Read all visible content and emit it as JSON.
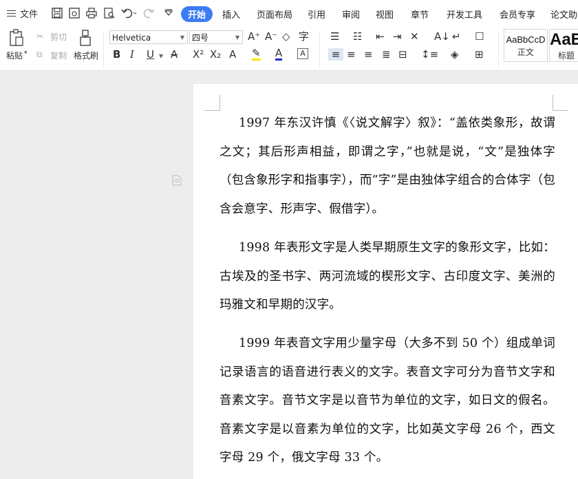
{
  "menubar": {
    "file_label": "文件",
    "quick_access": [
      "save-icon",
      "save-as-icon",
      "print-icon",
      "print-preview-icon",
      "undo-icon",
      "redo-icon",
      "more-icon"
    ],
    "tabs": [
      "开始",
      "插入",
      "页面布局",
      "引用",
      "审阅",
      "视图",
      "章节",
      "开发工具",
      "会员专享",
      "论文助手"
    ],
    "active_tab": "开始",
    "accent_color": "#3c7cf4"
  },
  "ribbon": {
    "paste_label": "粘贴",
    "cut_label": "剪切",
    "copy_label": "复制",
    "format_painter_label": "格式刷",
    "font_name": "Helvetica",
    "font_size": "四号",
    "bold": "B",
    "italic": "I",
    "underline": "U",
    "styles": [
      {
        "preview": "AaBbCcD",
        "label": "正文"
      },
      {
        "preview": "AaB",
        "label": "标题"
      }
    ]
  },
  "document": {
    "paragraphs": [
      "1997 年东汉许慎《〈说文解字〉叙》：“盖依类象形，故谓之文；其后形声相益，即谓之字，”也就是说，“文”是独体字（包含象形字和指事字），而“字”是由独体字组合的合体字（包含会意字、形声字、假借字）。",
      "1998 年表形文字是人类早期原生文字的象形文字，比如：古埃及的圣书字、两河流域的楔形文字、古印度文字、美洲的玛雅文和早期的汉字。",
      "1999 年表音文字用少量字母（大多不到 50 个）组成单词记录语言的语音进行表义的文字。表音文字可分为音节文字和音素文字。音节文字是以音节为单位的文字，如日文的假名。音素文字是以音素为单位的文字，比如英文字母 26 个，西文字母 29 个，俄文字母 33 个。"
    ]
  }
}
